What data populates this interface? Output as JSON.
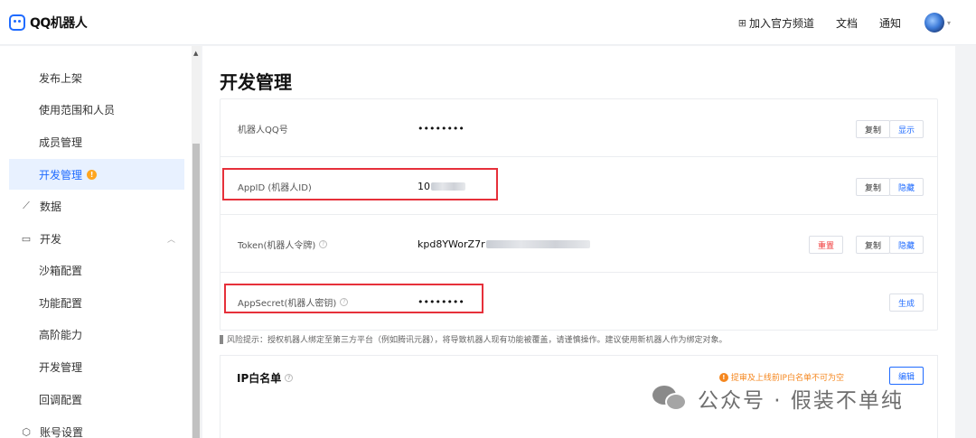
{
  "header": {
    "logo_text": "QQ机器人",
    "join_channel": "加入官方频道",
    "docs": "文档",
    "notify": "通知",
    "grid_icon": "⊞",
    "caret": "▾"
  },
  "sidebar": {
    "items": [
      {
        "label": "发布上架"
      },
      {
        "label": "使用范围和人员"
      },
      {
        "label": "成员管理"
      },
      {
        "label": "开发管理",
        "badge": "!"
      },
      {
        "label": "数据",
        "icon": "📈"
      },
      {
        "label": "开发",
        "icon": "🖵"
      },
      {
        "label": "沙箱配置"
      },
      {
        "label": "功能配置"
      },
      {
        "label": "高阶能力"
      },
      {
        "label": "开发管理"
      },
      {
        "label": "回调配置"
      },
      {
        "label": "账号设置",
        "icon": "⬡"
      }
    ],
    "collapse_glyph": "︿"
  },
  "main": {
    "title": "开发管理",
    "rows": [
      {
        "label": "机器人QQ号",
        "value": "••••••••",
        "buttons": [
          "复制",
          "显示"
        ]
      },
      {
        "label": "AppID (机器人ID)",
        "value": "10",
        "buttons": [
          "复制",
          "隐藏"
        ]
      },
      {
        "label": "Token(机器人令牌)",
        "value": "kpd8YWorZ7r",
        "buttons": [
          "重置",
          "复制",
          "隐藏"
        ]
      },
      {
        "label": "AppSecret(机器人密钥)",
        "value": "••••••••",
        "buttons": [
          "生成"
        ]
      }
    ],
    "risk_text": "风险提示：授权机器人绑定至第三方平台（例如腾讯元器），将导致机器人现有功能被覆盖，请谨慎操作。建议使用新机器人作为绑定对象。",
    "ip_section": {
      "title": "IP白名单",
      "warning": "提审及上线前IP白名单不可为空",
      "edit": "编辑"
    }
  },
  "watermark": {
    "text": "公众号 · 假装不单纯"
  },
  "colors": {
    "accent": "#1f6bff",
    "danger": "#f03a3a",
    "warning": "#f5871f",
    "highlight_box": "#e6303a"
  }
}
